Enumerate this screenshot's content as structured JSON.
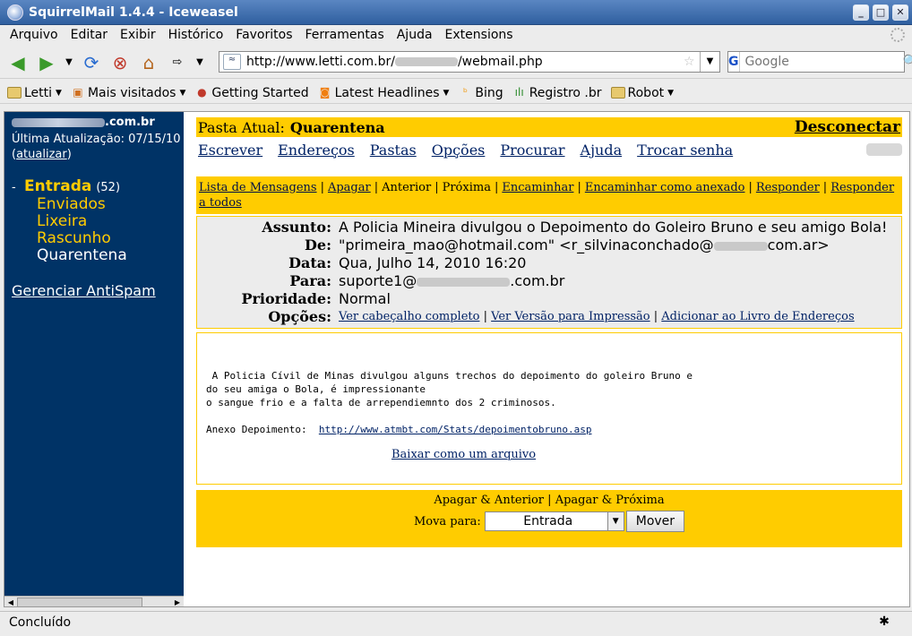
{
  "window": {
    "title": "SquirrelMail 1.4.4 - Iceweasel"
  },
  "menu": [
    "Arquivo",
    "Editar",
    "Exibir",
    "Histórico",
    "Favoritos",
    "Ferramentas",
    "Ajuda",
    "Extensions"
  ],
  "navbar": {
    "url_prefix": "http://www.letti.com.br/",
    "url_suffix": "/webmail.php",
    "search_engine": "G",
    "search_placeholder": "Google"
  },
  "bookmarks": [
    "Letti",
    "Mais visitados",
    "Getting Started",
    "Latest Headlines",
    "Bing",
    "Registro .br",
    "Robot"
  ],
  "sidebar": {
    "user_suffix": ".com.br",
    "last_update_label": "Última Atualização: 07/15/10",
    "refresh_open": "(",
    "refresh_link": "atualizar",
    "refresh_close": ")",
    "folders": {
      "dash": "-",
      "inbox": "Entrada",
      "inbox_count": "(52)",
      "sub": [
        "Enviados",
        "Lixeira",
        "Rascunho",
        "Quarentena"
      ]
    },
    "antispam": "Gerenciar AntiSpam"
  },
  "topbar": {
    "label": "Pasta Atual:",
    "folder": "Quarentena",
    "logout": "Desconectar"
  },
  "nav_links": [
    "Escrever",
    "Endereços",
    "Pastas",
    "Opções",
    "Procurar",
    "Ajuda",
    "Trocar senha"
  ],
  "actions": {
    "list": "Lista de Mensagens",
    "delete": "Apagar",
    "previous": "Anterior",
    "next": "Próxima",
    "forward": "Encaminhar",
    "forward_attach": "Encaminhar como anexado",
    "reply": "Responder",
    "reply_all": "Responder a todos"
  },
  "headers": {
    "subject_label": "Assunto:",
    "subject": "A Policia Mineira divulgou o Depoimento do Goleiro Bruno e seu amigo Bola!",
    "from_label": "De:",
    "from_pre": "\"primeira_mao@hotmail.com\" <r_silvinaconchado@",
    "from_post": "com.ar>",
    "date_label": "Data:",
    "date": "Qua, Julho 14, 2010 16:20",
    "to_label": "Para:",
    "to_pre": "suporte1@",
    "to_post": ".com.br",
    "priority_label": "Prioridade:",
    "priority": "Normal",
    "options_label": "Opções:",
    "options": [
      "Ver cabeçalho completo",
      "Ver Versão para Impressão",
      "Adicionar ao Livro de Endereços"
    ]
  },
  "body": {
    "line1": " A Policia Cívil de Minas divulgou alguns trechos do depoimento do goleiro Bruno e",
    "line2": "do seu amiga o Bola, é impressionante",
    "line3": "o sangue frio e a falta de arrependiemnto dos 2 criminosos.",
    "attach_label": "Anexo Depoimento:  ",
    "attach_link": "http://www.atmbt.com/Stats/depoimentobruno.asp",
    "download": "Baixar como um arquivo"
  },
  "bottom": {
    "delete_prev": "Apagar & Anterior",
    "delete_next": "Apagar & Próxima",
    "move_label": "Mova para:",
    "move_target": "Entrada",
    "move_button": "Mover"
  },
  "status": {
    "text": "Concluído"
  }
}
